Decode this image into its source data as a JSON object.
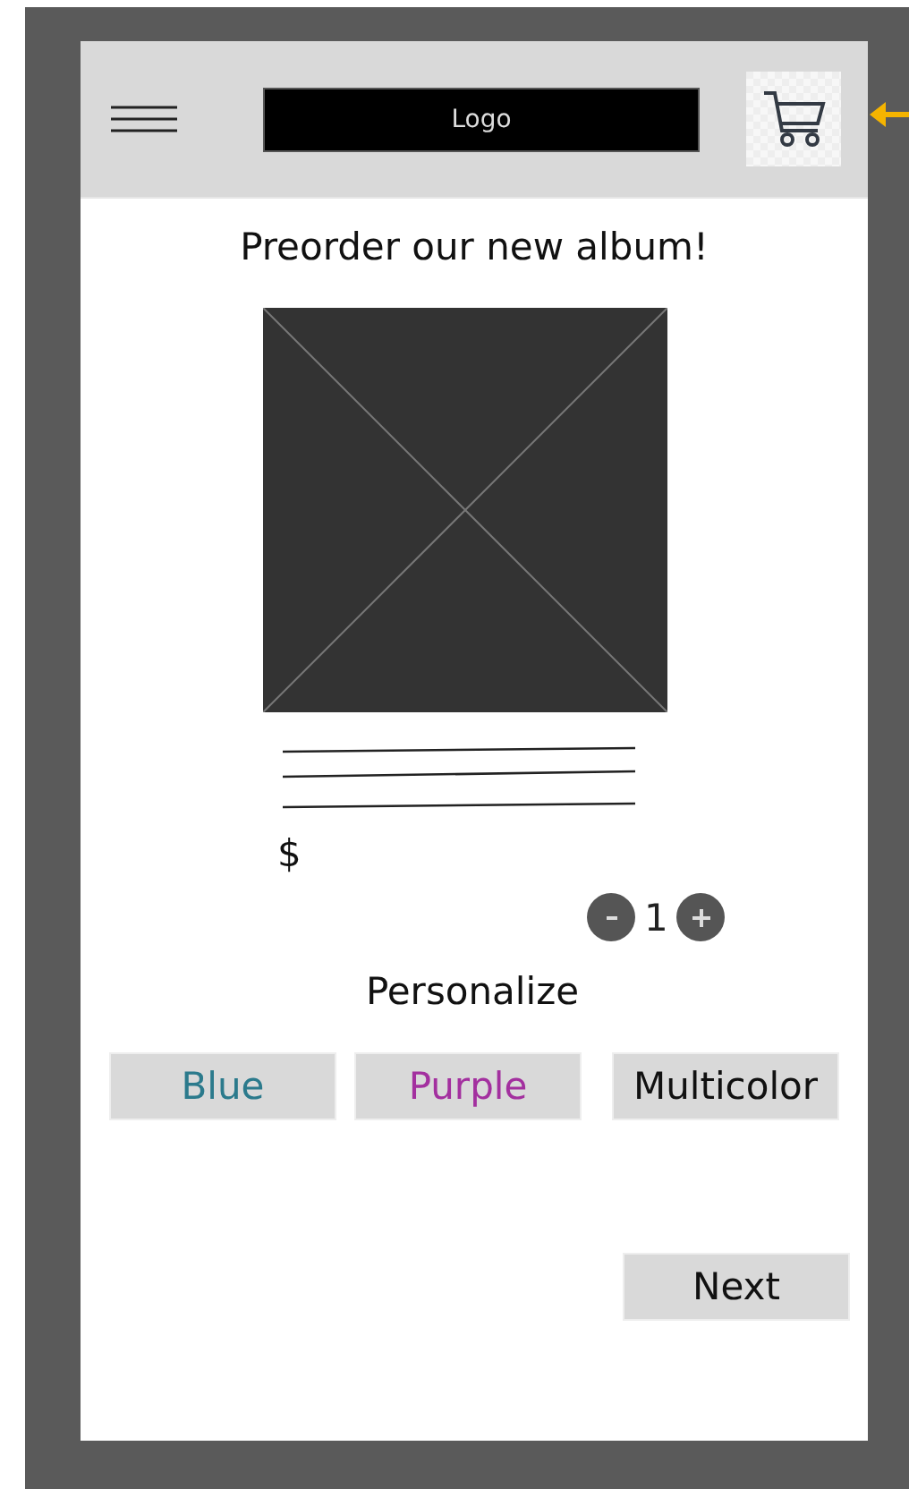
{
  "header": {
    "logo": "Logo"
  },
  "title": "Preorder our new album!",
  "product": {
    "price": "$",
    "quantity": "1"
  },
  "personalize": {
    "heading": "Personalize",
    "options": [
      {
        "label": "Blue",
        "color": "#2b7a8c"
      },
      {
        "label": "Purple",
        "color": "#a3309f"
      },
      {
        "label": "Multicolor",
        "color": "#111111"
      }
    ]
  },
  "next_button": "Next"
}
